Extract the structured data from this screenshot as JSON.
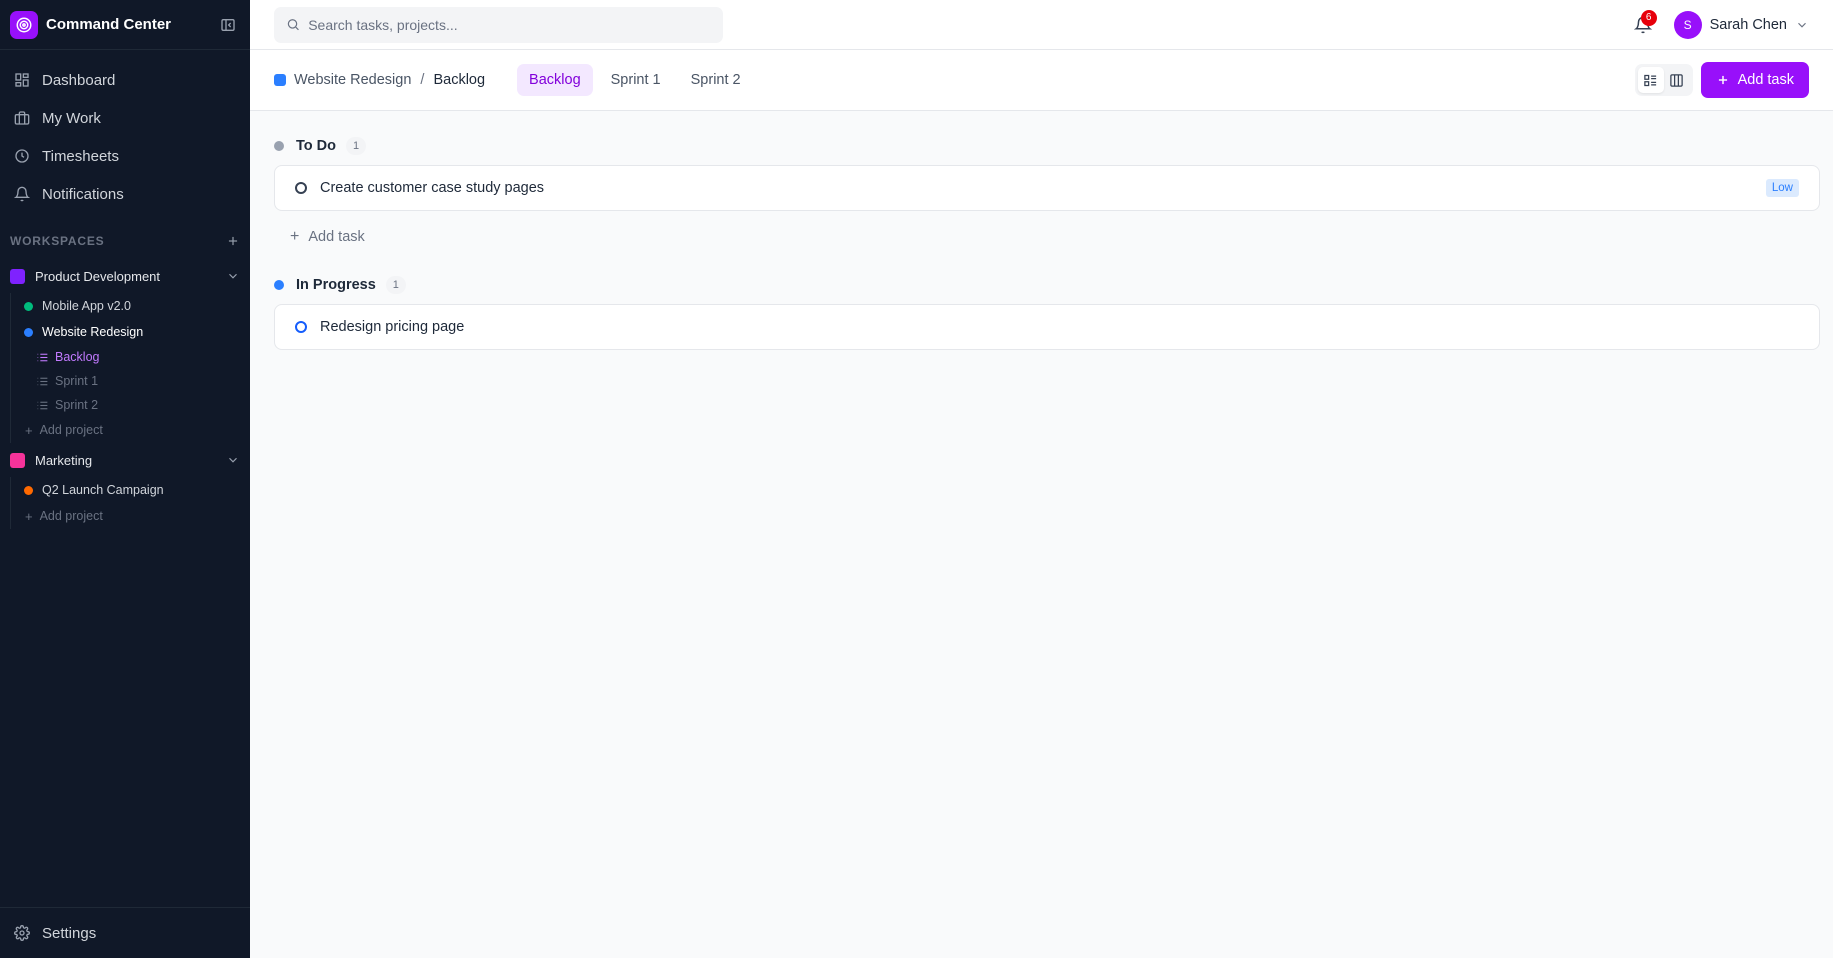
{
  "app": {
    "title": "Command Center",
    "brand_color": "#9810fa"
  },
  "sidebar": {
    "nav": [
      {
        "label": "Dashboard",
        "icon": "dashboard-icon"
      },
      {
        "label": "My Work",
        "icon": "briefcase-icon"
      },
      {
        "label": "Timesheets",
        "icon": "clock-icon"
      },
      {
        "label": "Notifications",
        "icon": "bell-icon"
      }
    ],
    "workspaces_label": "WORKSPACES",
    "workspaces": [
      {
        "name": "Product Development",
        "color": "#7f22fe",
        "projects": [
          {
            "name": "Mobile App v2.0",
            "color": "#00bc7d"
          },
          {
            "name": "Website Redesign",
            "color": "#2b7fff",
            "lists": [
              "Backlog",
              "Sprint 1",
              "Sprint 2"
            ]
          }
        ],
        "add_project": "Add project"
      },
      {
        "name": "Marketing",
        "color": "#f6339a",
        "projects": [
          {
            "name": "Q2 Launch Campaign",
            "color": "#ff6900"
          }
        ],
        "add_project": "Add project"
      }
    ],
    "settings_label": "Settings"
  },
  "topbar": {
    "search_placeholder": "Search tasks, projects...",
    "notification_count": "6",
    "user": {
      "initial": "S",
      "name": "Sarah Chen"
    }
  },
  "subheader": {
    "breadcrumb": {
      "project": "Website Redesign",
      "separator": "/",
      "current": "Backlog"
    },
    "tabs": [
      "Backlog",
      "Sprint 1",
      "Sprint 2"
    ],
    "add_task_label": "Add task"
  },
  "groups": [
    {
      "title": "To Do",
      "count": "1",
      "color": "#99a1af",
      "tasks": [
        {
          "title": "Create customer case study pages",
          "priority": "Low"
        }
      ],
      "add_task": "Add task"
    },
    {
      "title": "In Progress",
      "count": "1",
      "color": "#2b7fff",
      "tasks": [
        {
          "title": "Redesign pricing page"
        }
      ]
    }
  ]
}
